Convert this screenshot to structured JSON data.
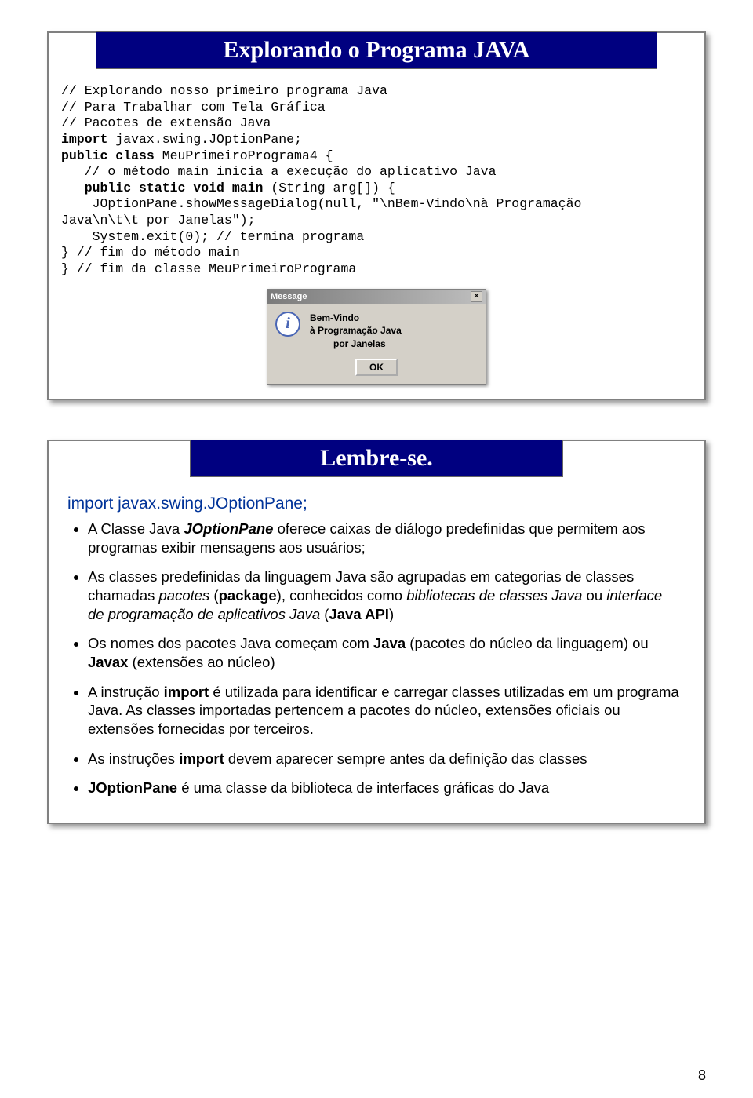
{
  "slide1": {
    "title": "Explorando o Programa JAVA",
    "code": {
      "l1": "// Explorando nosso primeiro programa Java",
      "l2": "// Para Trabalhar com Tela Gráfica",
      "l3": "// Pacotes de extensão Java",
      "l4a": "import",
      "l4b": " javax.swing.JOptionPane;",
      "l5a": "public class",
      "l5b": " MeuPrimeiroPrograma4 {",
      "l6": "   // o método main inicia a execução do aplicativo Java",
      "l7a": "   public static void main",
      "l7b": " (String arg[]) {",
      "l8": "    JOptionPane.showMessageDialog(null, \"\\nBem-Vindo\\nà Programação",
      "l9": "Java\\n\\t\\t por Janelas\");",
      "l10": "    System.exit(0); // termina programa",
      "l11": "} // fim do método main",
      "l12": "} // fim da classe MeuPrimeiroPrograma"
    },
    "dialog": {
      "title": "Message",
      "icon": "i",
      "line1": "Bem-Vindo",
      "line2": "à Programação Java",
      "line3": "         por Janelas",
      "ok": "OK",
      "close": "×"
    }
  },
  "slide2": {
    "title": "Lembre-se.",
    "import_line": "import javax.swing.JOptionPane;",
    "bullets": {
      "b1a": "A Classe Java ",
      "b1b": "JOptionPane",
      "b1c": " oferece caixas de diálogo predefinidas que permitem aos programas exibir mensagens aos usuários;",
      "b2a": "As classes predefinidas da linguagem Java são agrupadas em categorias de classes chamadas ",
      "b2b": "pacotes",
      "b2c": " (",
      "b2d": "package",
      "b2e": "), conhecidos como ",
      "b2f": "bibliotecas de classes Java",
      "b2g": " ou ",
      "b2h": "interface de programação de aplicativos Java",
      "b2i": " (",
      "b2j": "Java API",
      "b2k": ")",
      "b3a": "Os nomes dos pacotes Java começam com ",
      "b3b": "Java",
      "b3c": " (pacotes do núcleo da linguagem) ou ",
      "b3d": "Javax",
      "b3e": " (extensões ao núcleo)",
      "b4a": "A instrução ",
      "b4b": "import",
      "b4c": " é utilizada para identificar e carregar classes utilizadas em um programa Java. As classes importadas pertencem a pacotes do núcleo, extensões oficiais ou extensões fornecidas por terceiros.",
      "b5a": "As instruções ",
      "b5b": "import",
      "b5c": " devem aparecer sempre antes da definição das classes",
      "b6a": "JOptionPane",
      "b6b": " é uma classe da biblioteca de interfaces gráficas do Java"
    }
  },
  "page_number": "8"
}
